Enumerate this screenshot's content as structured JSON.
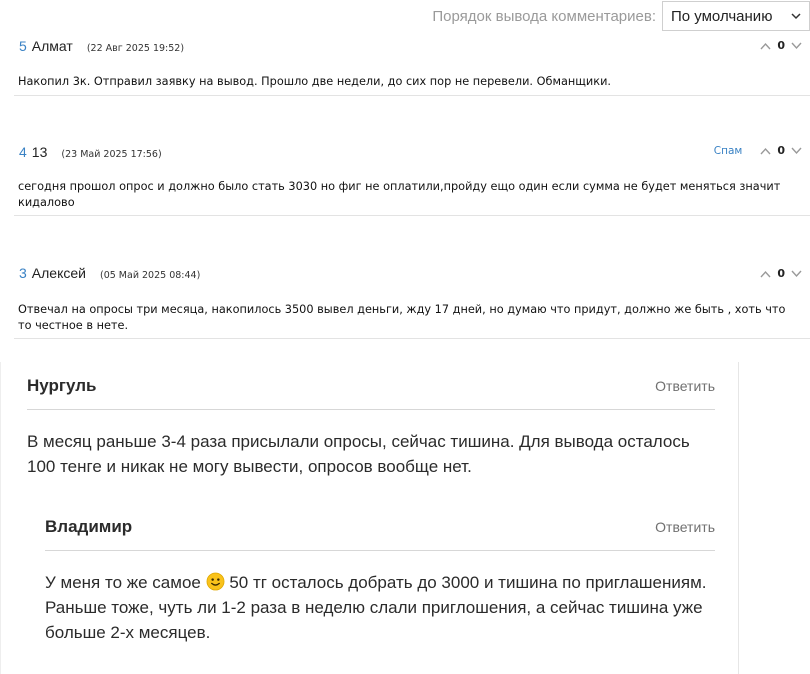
{
  "sort": {
    "label": "Порядок вывода комментариев:",
    "selected": "По умолчанию"
  },
  "comments": [
    {
      "num": "5",
      "author": "Алмат",
      "date": "(22 Авг 2025 19:52)",
      "score": "0",
      "spam": "",
      "text": "Накопил 3к. Отправил заявку на вывод. Прошло две недели, до сих пор не перевели. Обманщики."
    },
    {
      "num": "4",
      "author": "13",
      "date": "(23 Май 2025 17:56)",
      "score": "0",
      "spam": "Спам",
      "text": "сегодня прошол опрос и должно было стать 3030 но фиг не оплатили,пройду ещо один если сумма не будет меняться значит кидалово"
    },
    {
      "num": "3",
      "author": "Алексей",
      "date": "(05 Май 2025 08:44)",
      "score": "0",
      "spam": "",
      "text": "Отвечал на опросы три месяца, накопилось 3500 вывел деньги, жду 17 дней, но думаю что придут, должно же быть , хоть что то честное в нете."
    }
  ],
  "thread": {
    "reply_label": "Ответить",
    "main": {
      "author": "Нургуль",
      "text": "В месяц раньше 3-4 раза присылали опросы, сейчас тишина. Для вывода осталось 100 тенге и никак не могу вывести, опросов вообще нет."
    },
    "reply": {
      "author": "Владимир",
      "text_before": "У меня то же самое ",
      "emoji": "slightly-smiling-face",
      "text_after": " 50 тг осталось добрать до 3000 и тишина по приглаше­ниям. Раньше тоже, чуть ли 1-2 раза в неделю слали приглошения, а сейчас тишина уже больше 2-х месяцев."
    }
  }
}
